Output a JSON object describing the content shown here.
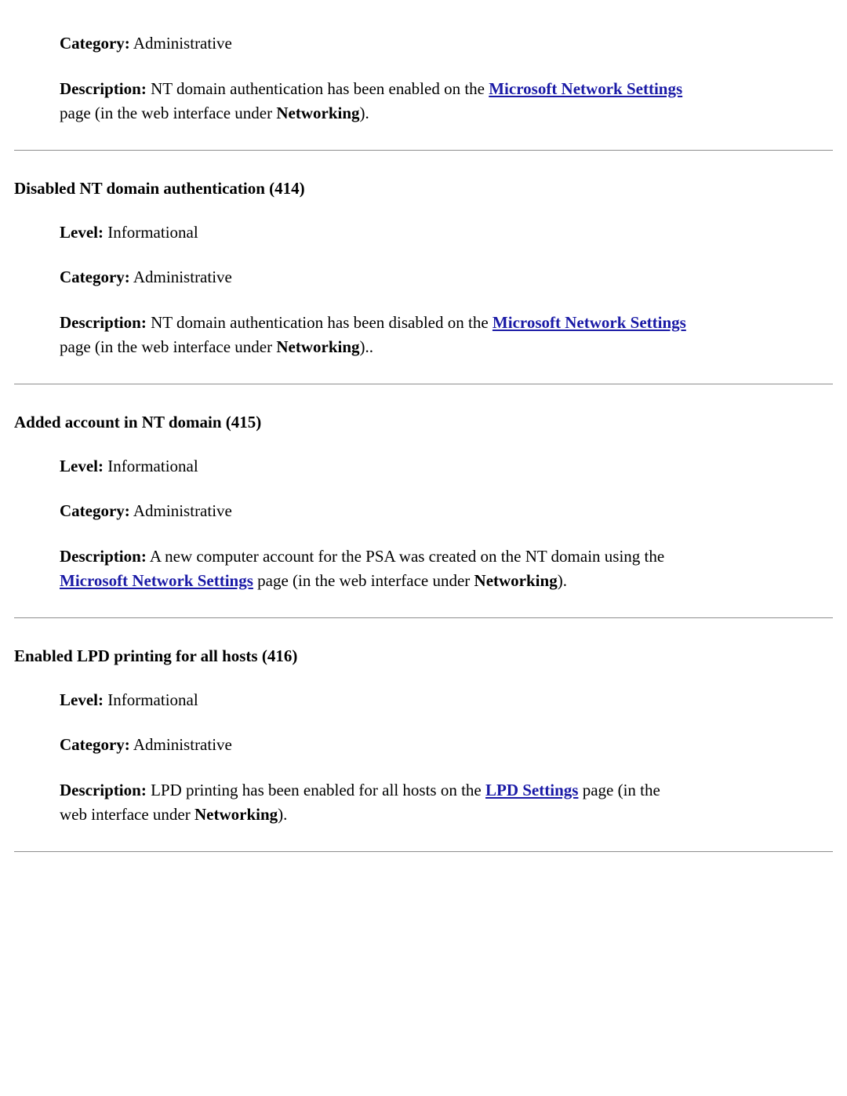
{
  "labels": {
    "level": "Level:",
    "category": "Category:",
    "description": "Description:"
  },
  "links": {
    "msn": "Microsoft Network Settings",
    "lpd": "LPD Settings"
  },
  "bold_terms": {
    "networking": "Networking"
  },
  "sections": [
    {
      "heading": "",
      "category": "Administrative",
      "desc_pre": "NT domain authentication has been enabled on the ",
      "link_key": "msn",
      "desc_mid": " page (in the web interface under ",
      "desc_post": ")."
    },
    {
      "heading": "Disabled NT domain authentication (414)",
      "level": "Informational",
      "category": "Administrative",
      "desc_pre": "NT domain authentication has been disabled on the ",
      "link_key": "msn",
      "desc_mid": " page (in the web interface under ",
      "desc_post": ").."
    },
    {
      "heading": "Added account in NT domain (415)",
      "level": "Informational",
      "category": "Administrative",
      "desc_pre": "A new computer account for the PSA was created on the NT domain using the ",
      "link_key": "msn",
      "desc_mid": " page (in the web interface under ",
      "desc_post": ")."
    },
    {
      "heading": "Enabled LPD printing for all hosts (416)",
      "level": "Informational",
      "category": "Administrative",
      "desc_pre": "LPD printing has been enabled for all hosts on the ",
      "link_key": "lpd",
      "desc_mid": " page (in the web interface under ",
      "desc_post": ")."
    }
  ]
}
